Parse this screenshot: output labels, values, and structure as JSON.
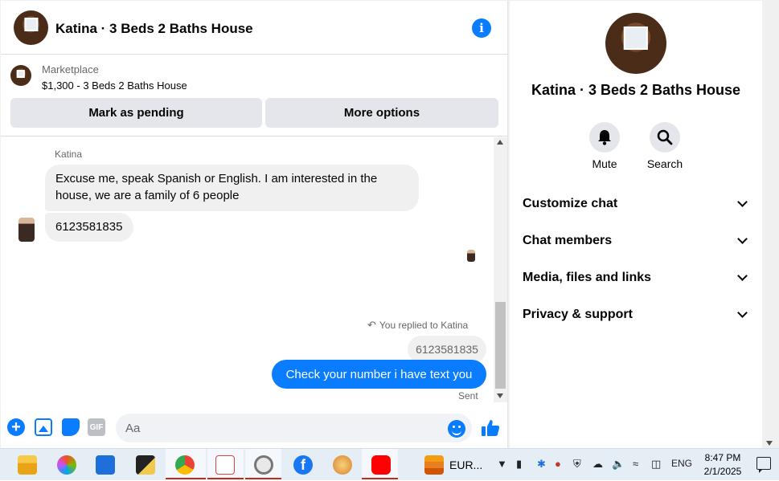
{
  "header": {
    "title": "Katina · 3 Beds 2 Baths House",
    "info_icon": "info-icon"
  },
  "marketplace": {
    "label": "Marketplace",
    "listing": "$1,300 - 3 Beds 2 Baths House",
    "mark_pending_label": "Mark as pending",
    "more_options_label": "More options"
  },
  "messages": {
    "sender_name": "Katina",
    "incoming_1": "Excuse me, speak Spanish or English. I am interested in the house, we are a family of 6 people",
    "incoming_2": "6123581835",
    "replied_to": "You replied to Katina",
    "quoted": "6123581835",
    "outgoing": "Check your number i have text you",
    "status": "Sent"
  },
  "composer": {
    "placeholder": "Aa",
    "gif_label": "GIF"
  },
  "side_panel": {
    "title": "Katina · 3 Beds 2 Baths House",
    "mute_label": "Mute",
    "search_label": "Search",
    "sections": [
      "Customize chat",
      "Chat members",
      "Media, files and links",
      "Privacy & support"
    ]
  },
  "taskbar": {
    "app_label": "EUR...",
    "lang": "ENG",
    "time": "8:47 PM",
    "date": "2/1/2025"
  },
  "colors": {
    "accent": "#0a7cff",
    "bubble_in": "#f0f0f0",
    "button_bg": "#e4e6eb"
  }
}
